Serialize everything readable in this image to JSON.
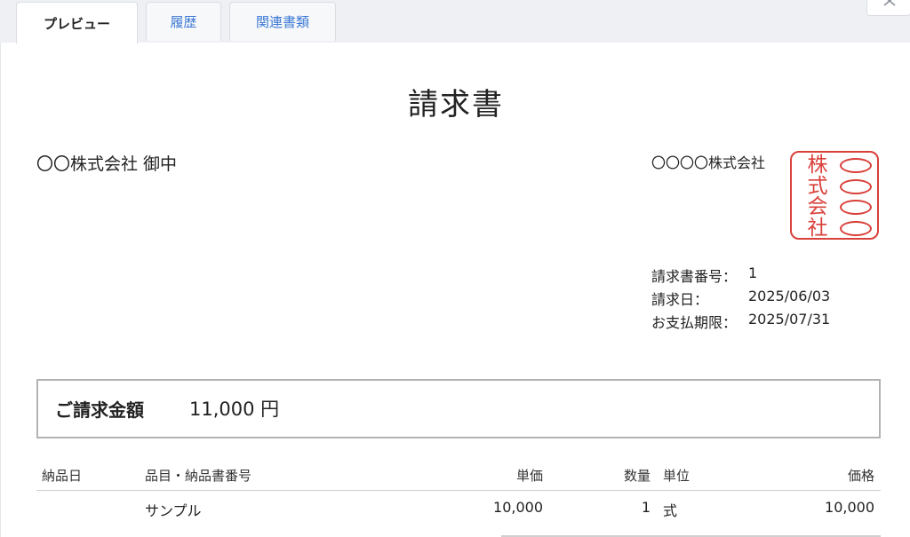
{
  "tabs": [
    {
      "label": "プレビュー",
      "active": true
    },
    {
      "label": "履歴",
      "active": false
    },
    {
      "label": "関連書類",
      "active": false
    }
  ],
  "close_icon": "close-icon",
  "invoice": {
    "title": "請求書",
    "recipient": "〇〇株式会社 御中",
    "issuer": "〇〇〇〇株式会社",
    "seal": {
      "characters": [
        "株",
        "式",
        "会",
        "社"
      ],
      "color": "#d9403a"
    },
    "meta": [
      {
        "label": "請求書番号：",
        "value": "1"
      },
      {
        "label": "請求日：",
        "value": "2025/06/03"
      },
      {
        "label": "お支払期限：",
        "value": "2025/07/31"
      }
    ],
    "amount_label": "ご請求金額",
    "amount_value": "11,000 円"
  },
  "table": {
    "headers": {
      "delivery_date": "納品日",
      "item": "品目・納品書番号",
      "unit_price": "単価",
      "quantity": "数量",
      "unit": "単位",
      "price": "価格"
    },
    "rows": [
      {
        "delivery_date": "",
        "item": "サンプル",
        "unit_price": "10,000",
        "quantity": "1",
        "unit": "式",
        "price": "10,000"
      }
    ]
  },
  "colors": {
    "accent_link": "#3d7ad6",
    "seal_red": "#d9403a",
    "tab_bar_bg": "#eef0f3"
  }
}
